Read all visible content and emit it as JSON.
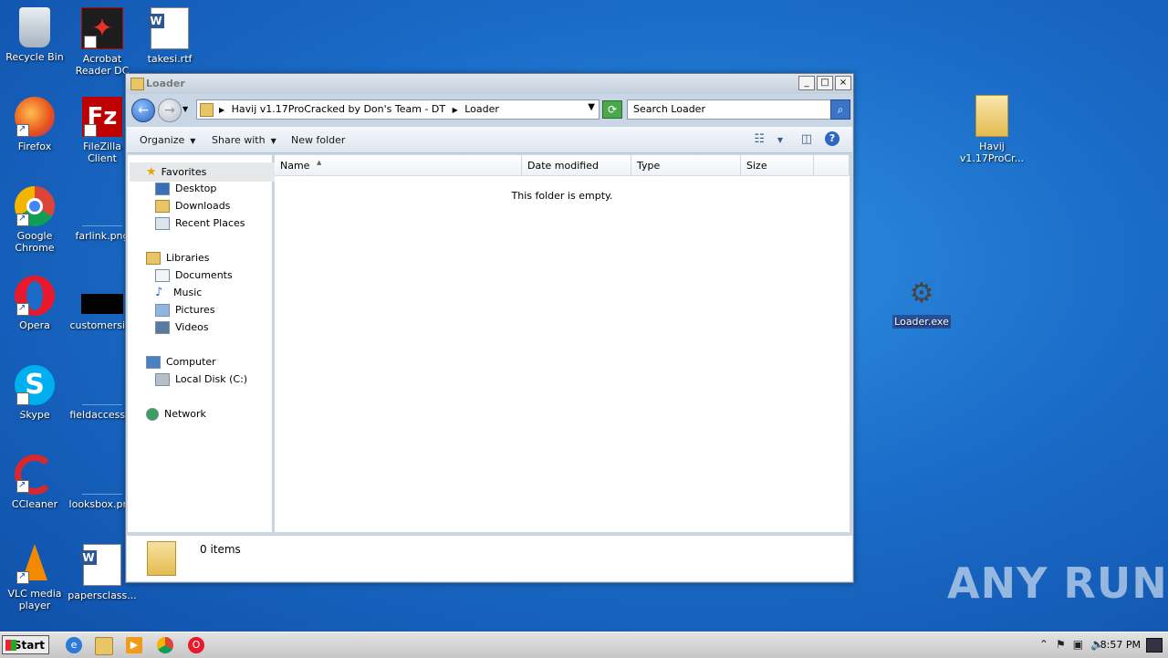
{
  "desktop": {
    "icons": [
      {
        "label": "Recycle Bin"
      },
      {
        "label": "Acrobat Reader DC"
      },
      {
        "label": "takesi.rtf"
      },
      {
        "label": "Firefox"
      },
      {
        "label": "FileZilla Client"
      },
      {
        "label": "Google Chrome"
      },
      {
        "label": "farlink.png"
      },
      {
        "label": "Opera"
      },
      {
        "label": "customersi..."
      },
      {
        "label": "Skype"
      },
      {
        "label": "fieldaccess..."
      },
      {
        "label": "CCleaner"
      },
      {
        "label": "looksbox.png"
      },
      {
        "label": "VLC media player"
      },
      {
        "label": "papersclass..."
      },
      {
        "label": "Havij v1.17ProCr..."
      },
      {
        "label": "Loader.exe"
      }
    ]
  },
  "window": {
    "title": "Loader",
    "controls": {
      "minimize": "_",
      "maximize": "□",
      "close": "×"
    },
    "address": {
      "crumb1": "Havij v1.17ProCracked by Don's Team - DT",
      "crumb2": "Loader"
    },
    "search": {
      "placeholder": "Search Loader"
    },
    "toolbar": {
      "organize": "Organize",
      "share": "Share with",
      "new_folder": "New folder",
      "help": "?"
    },
    "nav": {
      "favorites": "Favorites",
      "desktop": "Desktop",
      "downloads": "Downloads",
      "recent": "Recent Places",
      "libraries": "Libraries",
      "documents": "Documents",
      "music": "Music",
      "pictures": "Pictures",
      "videos": "Videos",
      "computer": "Computer",
      "local_disk": "Local Disk (C:)",
      "network": "Network"
    },
    "columns": {
      "name": "Name",
      "date": "Date modified",
      "type": "Type",
      "size": "Size"
    },
    "empty_message": "This folder is empty.",
    "status": "0 items"
  },
  "taskbar": {
    "start": "Start",
    "clock": "8:57 PM"
  },
  "watermark": "ANY RUN"
}
